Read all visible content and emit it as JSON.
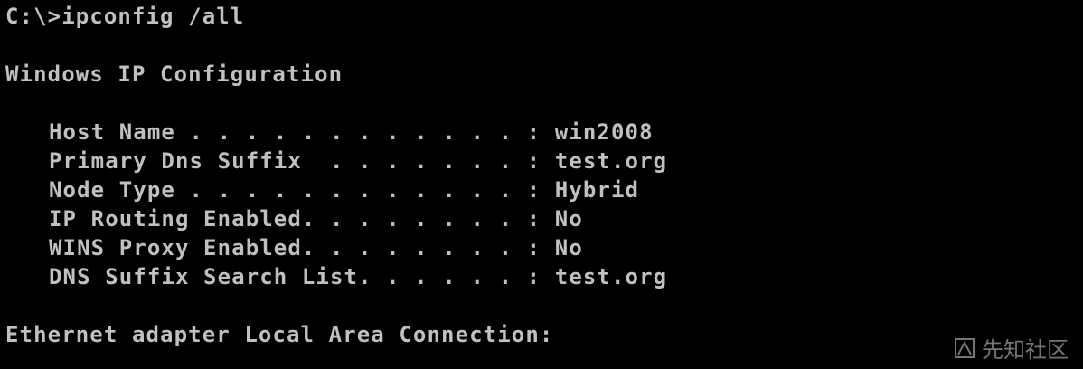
{
  "console": {
    "command_line": "C:\\>ipconfig /all",
    "heading": "Windows IP Configuration",
    "entries": [
      {
        "text": "Host Name . . . . . . . . . . . . : win2008"
      },
      {
        "text": "Primary Dns Suffix  . . . . . . . : test.org"
      },
      {
        "text": "Node Type . . . . . . . . . . . . : Hybrid"
      },
      {
        "text": "IP Routing Enabled. . . . . . . . : No"
      },
      {
        "text": "WINS Proxy Enabled. . . . . . . . : No"
      },
      {
        "text": "DNS Suffix Search List. . . . . . : test.org"
      }
    ],
    "adapter_heading": "Ethernet adapter Local Area Connection:"
  },
  "watermark": {
    "text": "先知社区",
    "icon": "xianzhi-logo-icon"
  },
  "colors": {
    "background": "#000000",
    "foreground": "#c0c0c0",
    "watermark": "#8a8a8a"
  }
}
